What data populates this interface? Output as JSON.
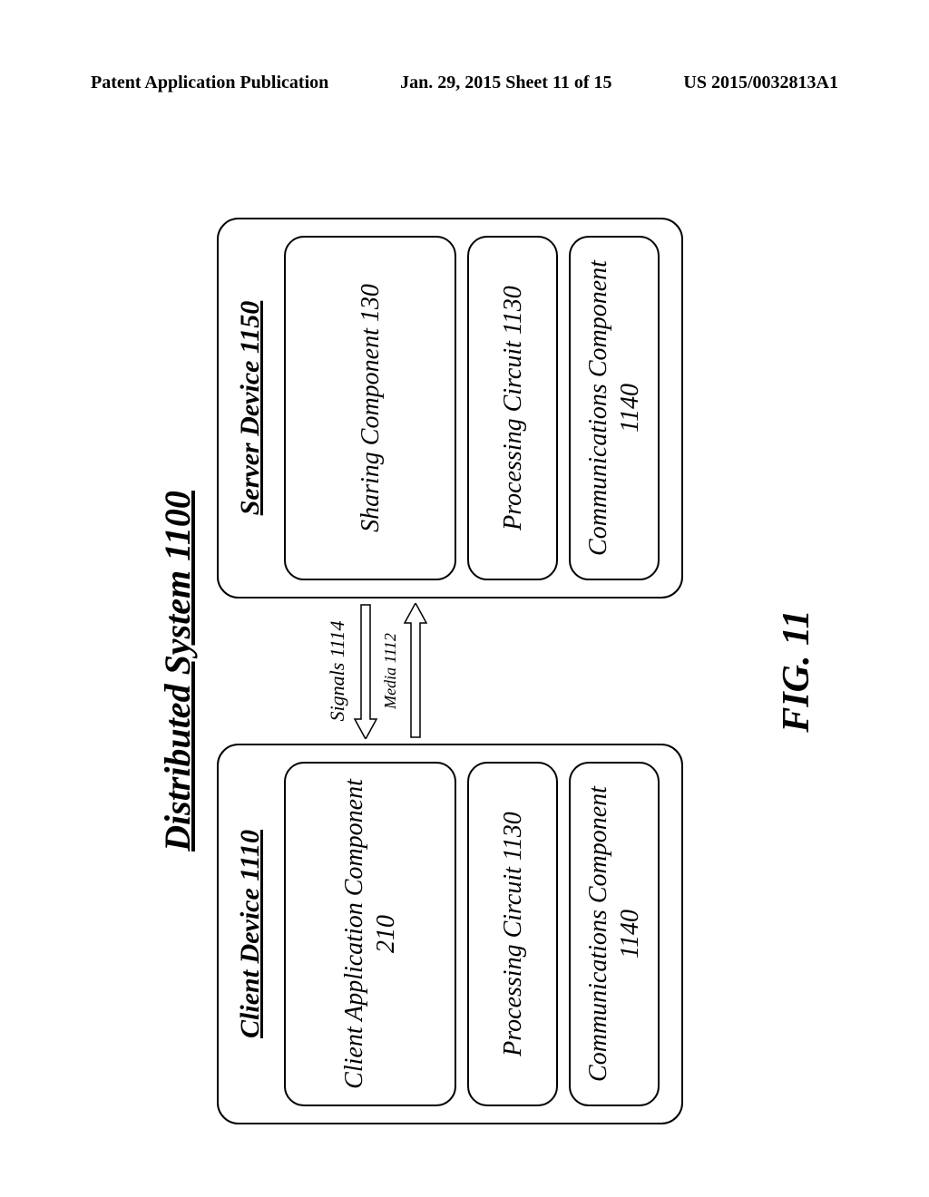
{
  "header": {
    "left": "Patent Application Publication",
    "center": "Jan. 29, 2015  Sheet 11 of 15",
    "right": "US 2015/0032813A1"
  },
  "system_title": "Distributed System 1100",
  "client": {
    "title": "Client Device 1110",
    "components": [
      "Client Application Component\n210",
      "Processing\nCircuit 1130",
      "Communications\nComponent 1140"
    ]
  },
  "link": {
    "signals": "Signals\n1114",
    "media": "Media 1112"
  },
  "server": {
    "title": "Server Device 1150",
    "components": [
      "Sharing Component\n130",
      "Processing\nCircuit 1130",
      "Communications\nComponent 1140"
    ]
  },
  "figure_caption": "FIG. 11"
}
